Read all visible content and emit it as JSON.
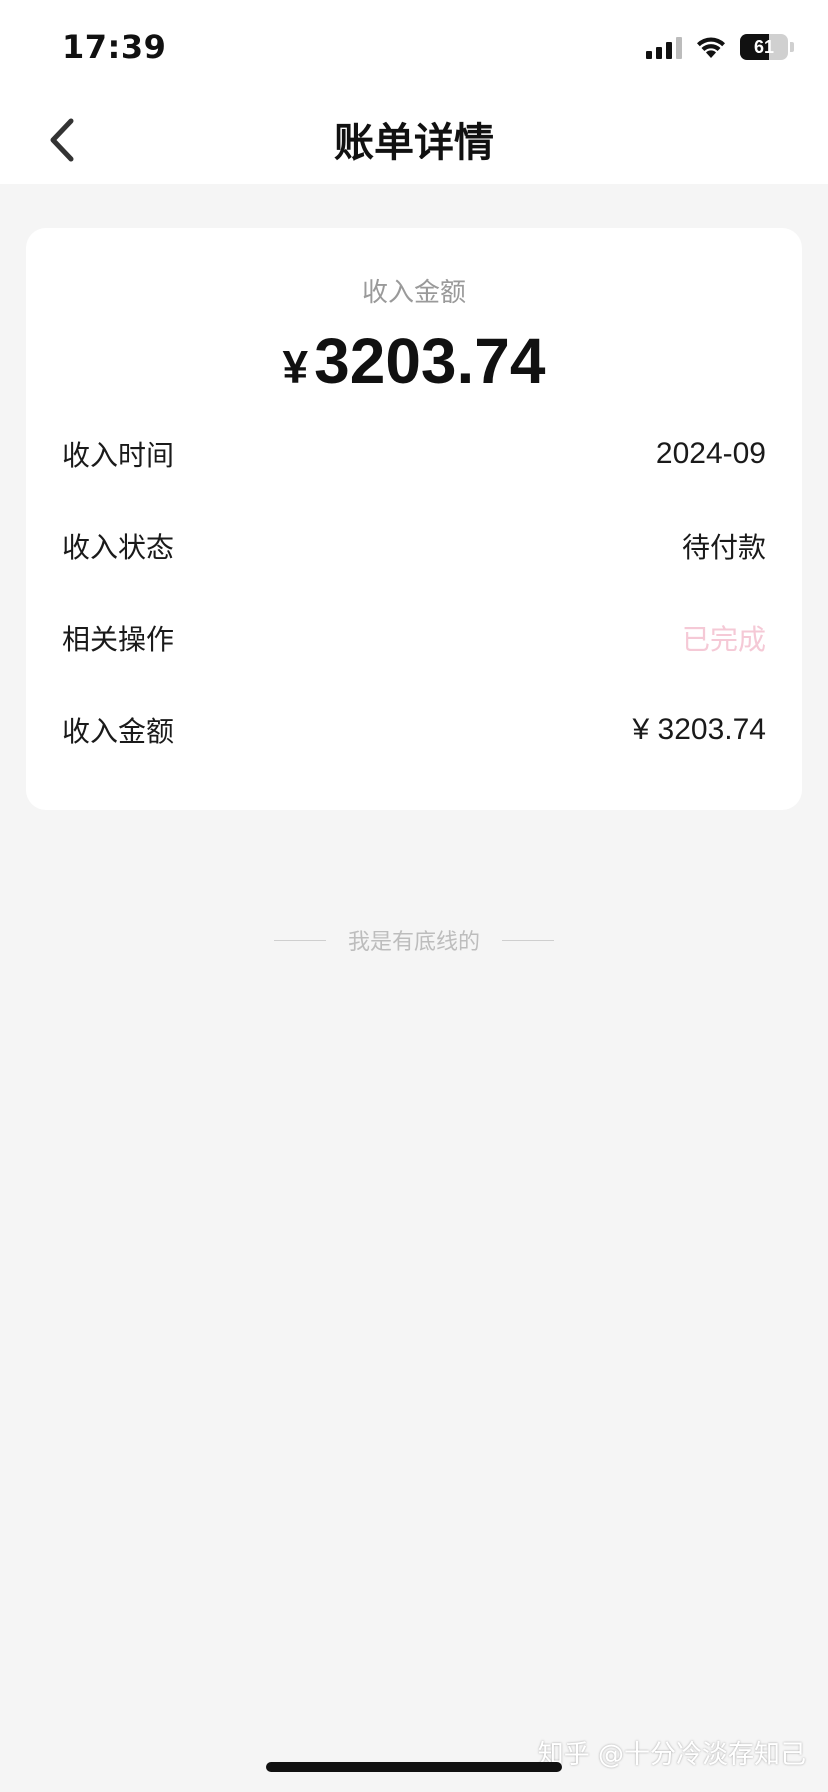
{
  "status_bar": {
    "time": "17:39",
    "battery_level": "61",
    "icons": [
      "signal-icon",
      "wifi-icon",
      "battery-icon"
    ]
  },
  "nav": {
    "back_icon": "chevron-left-icon",
    "title": "账单详情"
  },
  "card": {
    "amount_label": "收入金额",
    "amount_currency": "¥",
    "amount_value": "3203.74",
    "rows": [
      {
        "label": "收入时间",
        "value": "2024-09"
      },
      {
        "label": "收入状态",
        "value": "待付款"
      },
      {
        "label": "相关操作",
        "value": "已完成"
      },
      {
        "label": "收入金额",
        "value": "¥ 3203.74"
      }
    ]
  },
  "footer": {
    "text": "我是有底线的"
  },
  "watermark": {
    "text": "知乎 @十分冷淡存知己"
  },
  "colors": {
    "background": "#f5f5f5",
    "card": "#ffffff",
    "label_gray": "#9a9a9a",
    "action_pink": "#f5c9d6"
  }
}
